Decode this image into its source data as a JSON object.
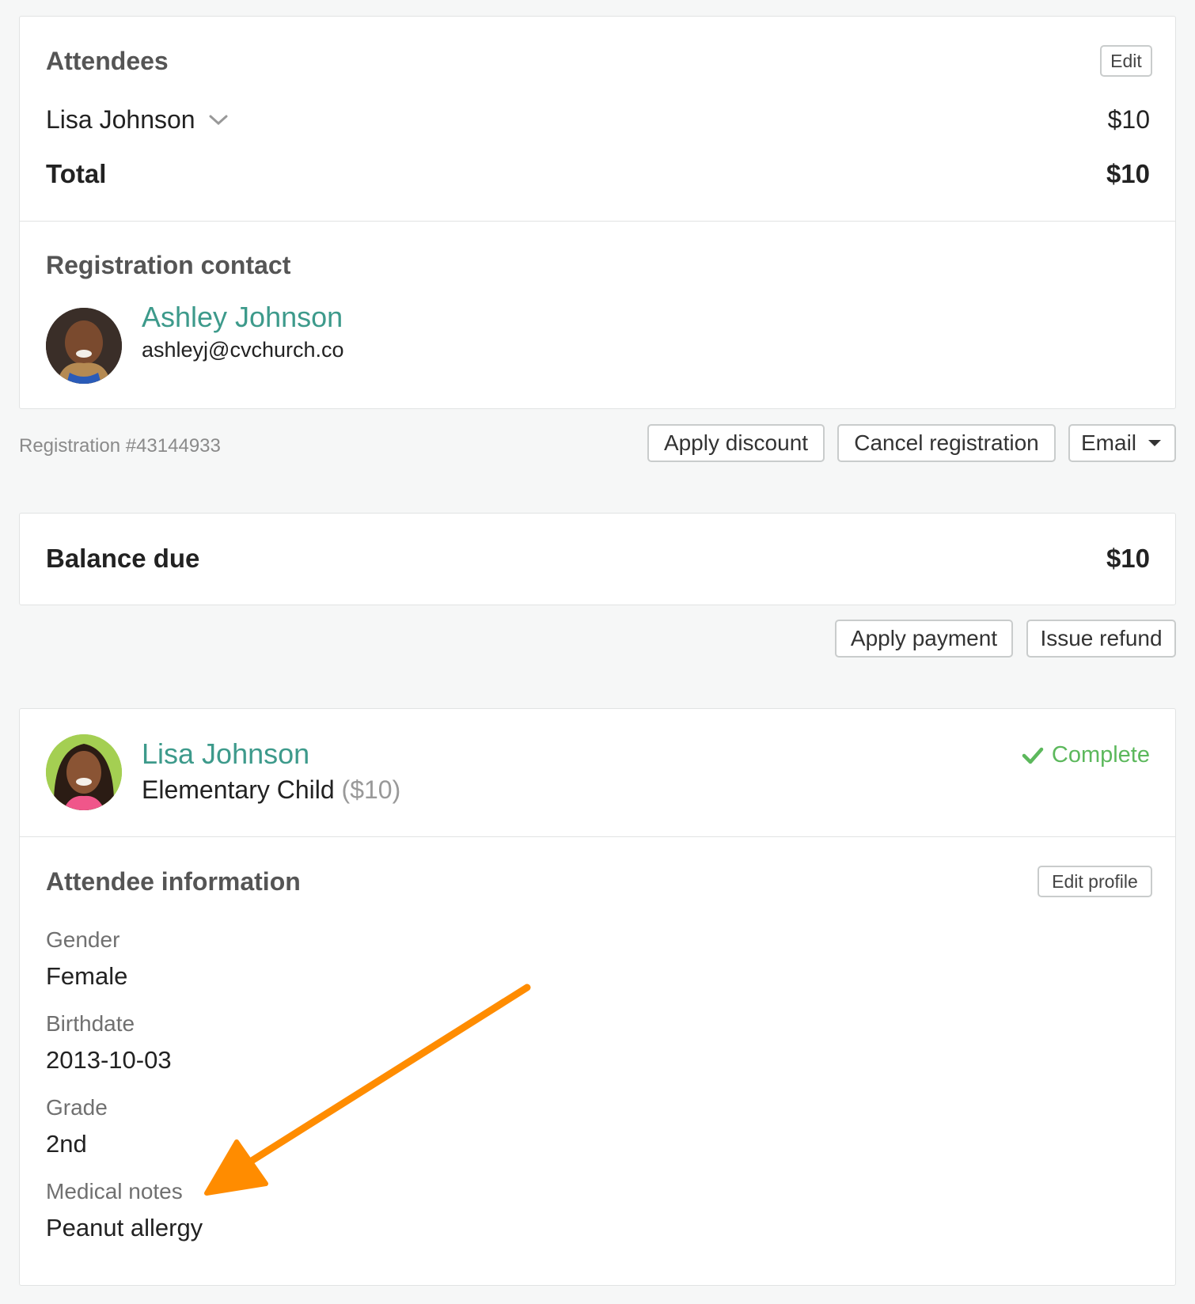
{
  "attendees_card": {
    "title": "Attendees",
    "edit_label": "Edit",
    "attendee_name": "Lisa Johnson",
    "attendee_price": "$10",
    "total_label": "Total",
    "total_value": "$10"
  },
  "contact": {
    "title": "Registration contact",
    "name": "Ashley Johnson",
    "email": "ashleyj@cvchurch.co"
  },
  "registration": {
    "number": "Registration #43144933",
    "apply_discount": "Apply discount",
    "cancel_registration": "Cancel registration",
    "email": "Email"
  },
  "balance": {
    "label": "Balance due",
    "value": "$10",
    "apply_payment": "Apply payment",
    "issue_refund": "Issue refund"
  },
  "attendee_detail": {
    "name": "Lisa Johnson",
    "ticket": "Elementary Child",
    "ticket_price": "($10)",
    "status": "Complete",
    "info_title": "Attendee information",
    "edit_profile": "Edit profile",
    "fields": [
      {
        "label": "Gender",
        "value": "Female"
      },
      {
        "label": "Birthdate",
        "value": "2013-10-03"
      },
      {
        "label": "Grade",
        "value": "2nd"
      },
      {
        "label": "Medical notes",
        "value": "Peanut allergy"
      }
    ]
  },
  "colors": {
    "link": "#3d9a8b",
    "complete": "#5cb85c",
    "arrow": "#ff8c00"
  },
  "icons": {
    "chevron": "chevron-down-icon",
    "caret": "caret-down-icon",
    "check": "checkmark-icon",
    "arrow": "annotation-arrow-icon"
  }
}
